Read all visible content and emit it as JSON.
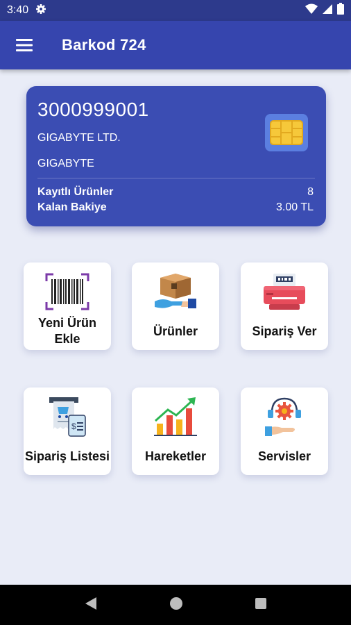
{
  "status_bar": {
    "time": "3:40"
  },
  "app_bar": {
    "title": "Barkod 724"
  },
  "card": {
    "number": "3000999001",
    "company": "GIGABYTE LTD.",
    "brand": "GIGABYTE",
    "registered_label": "Kayıtlı Ürünler",
    "registered_value": "8",
    "balance_label": "Kalan Bakiye",
    "balance_value": "3.00 TL"
  },
  "tiles": [
    {
      "label": "Yeni Ürün Ekle",
      "icon": "barcode-scan-icon"
    },
    {
      "label": "Ürünler",
      "icon": "box-in-hand-icon"
    },
    {
      "label": "Sipariş Ver",
      "icon": "printer-icon"
    },
    {
      "label": "Sipariş Listesi",
      "icon": "receipt-cart-icon"
    },
    {
      "label": "Hareketler",
      "icon": "bar-chart-growth-icon"
    },
    {
      "label": "Servisler",
      "icon": "service-gear-icon"
    }
  ],
  "colors": {
    "primary": "#3645ae",
    "status": "#2d3a8c",
    "card": "#3b4db3",
    "background": "#e9ecf7"
  }
}
